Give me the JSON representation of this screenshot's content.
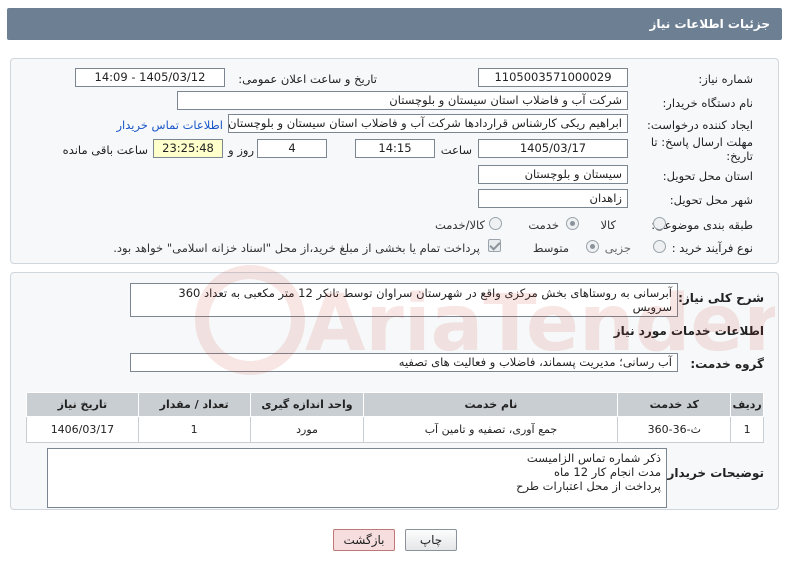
{
  "header": {
    "title": "جزئیات اطلاعات نیاز"
  },
  "details": {
    "need_number_label": "شماره نیاز:",
    "need_number": "1105003571000029",
    "announce_label": "تاریخ و ساعت اعلان عمومی:",
    "announce_value": "1405/03/12 - 14:09",
    "buyer_org_label": "نام دستگاه خریدار:",
    "buyer_org": "شرکت آب و فاضلاب استان سیستان و بلوچستان",
    "creator_label": "ایجاد کننده درخواست:",
    "creator": "ابراهیم ریکی کارشناس قراردادها شرکت آب و فاضلاب استان سیستان و بلوچستان",
    "contact_link": "اطلاعات تماس خریدار",
    "deadline_label": "مهلت ارسال پاسخ: تا تاریخ:",
    "deadline_date": "1405/03/17",
    "time_label": "ساعت",
    "deadline_time": "14:15",
    "days_value": "4",
    "days_label": "روز و",
    "remaining_time": "23:25:48",
    "remaining_label": "ساعت باقی مانده",
    "province_label": "استان محل تحویل:",
    "province": "سیستان و بلوچستان",
    "city_label": "شهر محل تحویل:",
    "city": "زاهدان",
    "category_label": "طبقه بندی موضوعی:",
    "category_options": [
      "کالا",
      "خدمت",
      "کالا/خدمت"
    ],
    "process_label": "نوع فرآیند خرید :",
    "process_options": [
      "جزیی",
      "متوسط"
    ],
    "payment_note": "پرداخت تمام یا بخشی از مبلغ خرید،از محل \"اسناد خزانه اسلامی\" خواهد بود."
  },
  "description": {
    "label": "شرح کلی نیاز:",
    "text": "آبرسانی به روستاهای بخش مرکزی واقع در شهرستان سراوان  توسط تانکر 12 متر مکعبی به تعداد 360 سرویس"
  },
  "services": {
    "title": "اطلاعات خدمات مورد نیاز",
    "group_label": "گروه خدمت:",
    "group_value": "آب رسانی؛ مدیریت پسماند، فاضلاب و فعالیت های تصفیه",
    "columns": [
      "ردیف",
      "کد خدمت",
      "نام خدمت",
      "واحد اندازه گیری",
      "تعداد / مقدار",
      "تاریخ نیاز"
    ],
    "rows": [
      [
        "1",
        "ث-36-360",
        "جمع آوری، تصفیه و تامین آب",
        "مورد",
        "1",
        "1406/03/17"
      ]
    ]
  },
  "buyer_notes": {
    "label": "توضیحات خریدار:",
    "lines": [
      "ذکر شماره تماس الزامیست",
      "مدت انجام کار  12 ماه",
      "پرداخت از محل اعتبارات طرح"
    ]
  },
  "buttons": {
    "print": "چاپ",
    "back": "بازگشت"
  },
  "watermark": {
    "text": "AriaTender.net"
  },
  "colors": {
    "header": "#6d7f93",
    "link": "#1a57c9",
    "highlight": "#ffffcc",
    "watermark": "#c0392b"
  }
}
